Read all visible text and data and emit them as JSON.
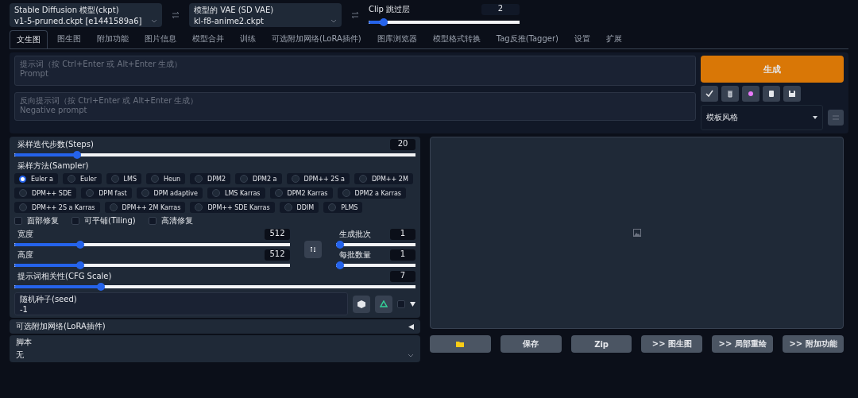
{
  "model_selects": [
    {
      "label": "Stable Diffusion 模型(ckpt)",
      "value": "v1-5-pruned.ckpt [e1441589a6]"
    },
    {
      "label": "模型的 VAE (SD VAE)",
      "value": "kl-f8-anime2.ckpt"
    }
  ],
  "clip_skip": {
    "label": "Clip 跳过层",
    "value": "2",
    "level": 0.08
  },
  "tabs": [
    {
      "label": "文生图",
      "selected": true
    },
    {
      "label": "图生图",
      "selected": false
    },
    {
      "label": "附加功能",
      "selected": false
    },
    {
      "label": "图片信息",
      "selected": false
    },
    {
      "label": "模型合并",
      "selected": false
    },
    {
      "label": "训练",
      "selected": false
    },
    {
      "label": "可选附加网络(LoRA插件)",
      "selected": false
    },
    {
      "label": "图库浏览器",
      "selected": false
    },
    {
      "label": "模型格式转换",
      "selected": false
    },
    {
      "label": "Tag反推(Tagger)",
      "selected": false
    },
    {
      "label": "设置",
      "selected": false
    },
    {
      "label": "扩展",
      "selected": false
    }
  ],
  "prompt": {
    "label": "提示词（按 Ctrl+Enter 或 Alt+Enter 生成）",
    "placeholder": "Prompt"
  },
  "negative_prompt": {
    "label": "反向提示词（按 Ctrl+Enter 或 Alt+Enter 生成）",
    "placeholder": "Negative prompt"
  },
  "generate_button": "生成",
  "tool_buttons": [
    {
      "kind": "check"
    },
    {
      "kind": "trash"
    },
    {
      "kind": "magic"
    },
    {
      "kind": "clipboard"
    },
    {
      "kind": "save"
    }
  ],
  "style_select": {
    "label": "模板风格"
  },
  "steps": {
    "label": "采样迭代步数(Steps)",
    "value": "20",
    "level": 0.15
  },
  "sampler": {
    "label": "采样方法(Sampler)",
    "options": [
      {
        "label": "Euler a",
        "selected": true
      },
      {
        "label": "Euler",
        "selected": false
      },
      {
        "label": "LMS",
        "selected": false
      },
      {
        "label": "Heun",
        "selected": false
      },
      {
        "label": "DPM2",
        "selected": false
      },
      {
        "label": "DPM2 a",
        "selected": false
      },
      {
        "label": "DPM++ 2S a",
        "selected": false
      },
      {
        "label": "DPM++ 2M",
        "selected": false
      },
      {
        "label": "DPM++ SDE",
        "selected": false
      },
      {
        "label": "DPM fast",
        "selected": false
      },
      {
        "label": "DPM adaptive",
        "selected": false
      },
      {
        "label": "LMS Karras",
        "selected": false
      },
      {
        "label": "DPM2 Karras",
        "selected": false
      },
      {
        "label": "DPM2 a Karras",
        "selected": false
      },
      {
        "label": "DPM++ 2S a Karras",
        "selected": false
      },
      {
        "label": "DPM++ 2M Karras",
        "selected": false
      },
      {
        "label": "DPM++ SDE Karras",
        "selected": false
      },
      {
        "label": "DDIM",
        "selected": false
      },
      {
        "label": "PLMS",
        "selected": false
      }
    ]
  },
  "checkboxes": [
    {
      "label": "面部修复",
      "checked": false
    },
    {
      "label": "可平铺(Tiling)",
      "checked": false
    },
    {
      "label": "高清修复",
      "checked": false
    }
  ],
  "width": {
    "label": "宽度",
    "value": "512",
    "level": 0.23
  },
  "height": {
    "label": "高度",
    "value": "512",
    "level": 0.23
  },
  "batch_count": {
    "label": "生成批次",
    "value": "1",
    "level": 0
  },
  "batch_size": {
    "label": "每批数量",
    "value": "1",
    "level": 0
  },
  "cfg": {
    "label": "提示词相关性(CFG Scale)",
    "value": "7",
    "level": 0.21
  },
  "seed": {
    "label": "随机种子(seed)",
    "value": "-1",
    "extra_checked": false
  },
  "lora_section": {
    "title": "可选附加网络(LoRA插件)",
    "expanded": false
  },
  "script": {
    "label": "脚本",
    "value": "无"
  },
  "output_buttons": [
    {
      "kind": "folder"
    },
    {
      "kind": "text",
      "label": "保存"
    },
    {
      "kind": "text",
      "label": "Zip"
    },
    {
      "kind": "text",
      "label": ">> 图生图"
    },
    {
      "kind": "text",
      "label": ">> 局部重绘"
    },
    {
      "kind": "text",
      "label": ">> 附加功能"
    }
  ]
}
